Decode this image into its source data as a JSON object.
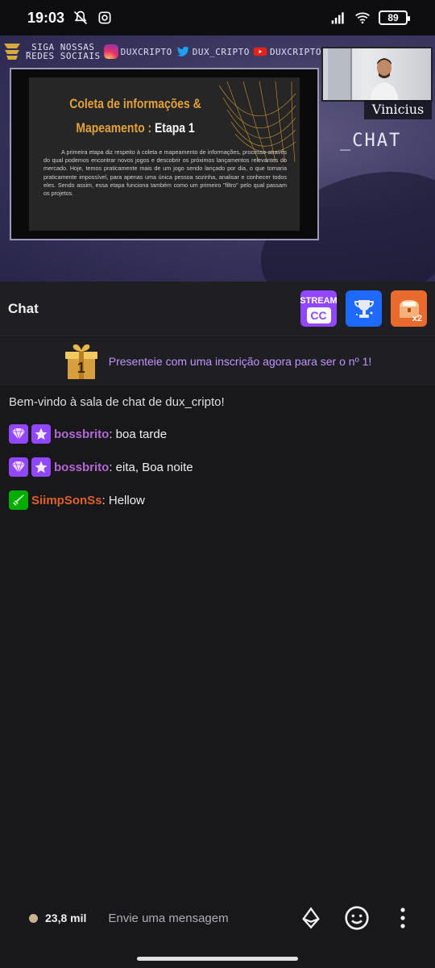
{
  "status_bar": {
    "time": "19:03",
    "battery": "89"
  },
  "video": {
    "overlay_siga": [
      "_SIGA NOSSAS",
      "REDES SOCIAIS"
    ],
    "social_handles": [
      {
        "icon": "instagram-icon",
        "handle": "DUXCRIPTO"
      },
      {
        "icon": "twitter-icon",
        "handle": "DUX_CRIPTO"
      },
      {
        "icon": "youtube-icon",
        "handle": "DUXCRIPTO"
      }
    ],
    "slide": {
      "title_line1": "Coleta de informações &",
      "title_line2": "Mapeamento :",
      "title_etapa": "Etapa 1",
      "paragraph": "A primeira etapa diz respeito à coleta e mapeamento de informações, processo através do qual podemos encontrar novos jogos e descobrir os próximos lançamentos relevantes do mercado. Hoje, temos praticamente mais de um jogo sendo lançado por dia, o que tornaria praticamente impossível, para apenas uma única pessoa sozinha, analisar e conhecer todos eles. Sendo assim, essa etapa funciona também como um primeiro \"filtro\" pelo qual passam os projetos."
    },
    "cam_name": "Vinicius",
    "chat_tag": "_CHAT"
  },
  "chat_header": {
    "title": "Chat",
    "stream_label": "STREAM",
    "cc_label": "CC",
    "chest_label": "x2"
  },
  "gift_banner": {
    "count": "1",
    "text": "Presenteie com uma inscrição agora para ser o nº 1!"
  },
  "messages": {
    "welcome": "Bem-vindo à sala de chat de dux_cripto!",
    "items": [
      {
        "user": "bossbrito",
        "text": ": boa tarde"
      },
      {
        "user": "bossbrito",
        "text": ": eita, Boa noite"
      },
      {
        "user": "SiimpSonSs",
        "text": ": Hellow"
      }
    ]
  },
  "input_bar": {
    "viewers": "23,8 mil",
    "placeholder": "Envie uma mensagem"
  },
  "colors": {
    "accent": "#9147ff",
    "user_purple": "#b568d6",
    "user_orange": "#e0612a",
    "slide_title": "#e3a23b"
  }
}
